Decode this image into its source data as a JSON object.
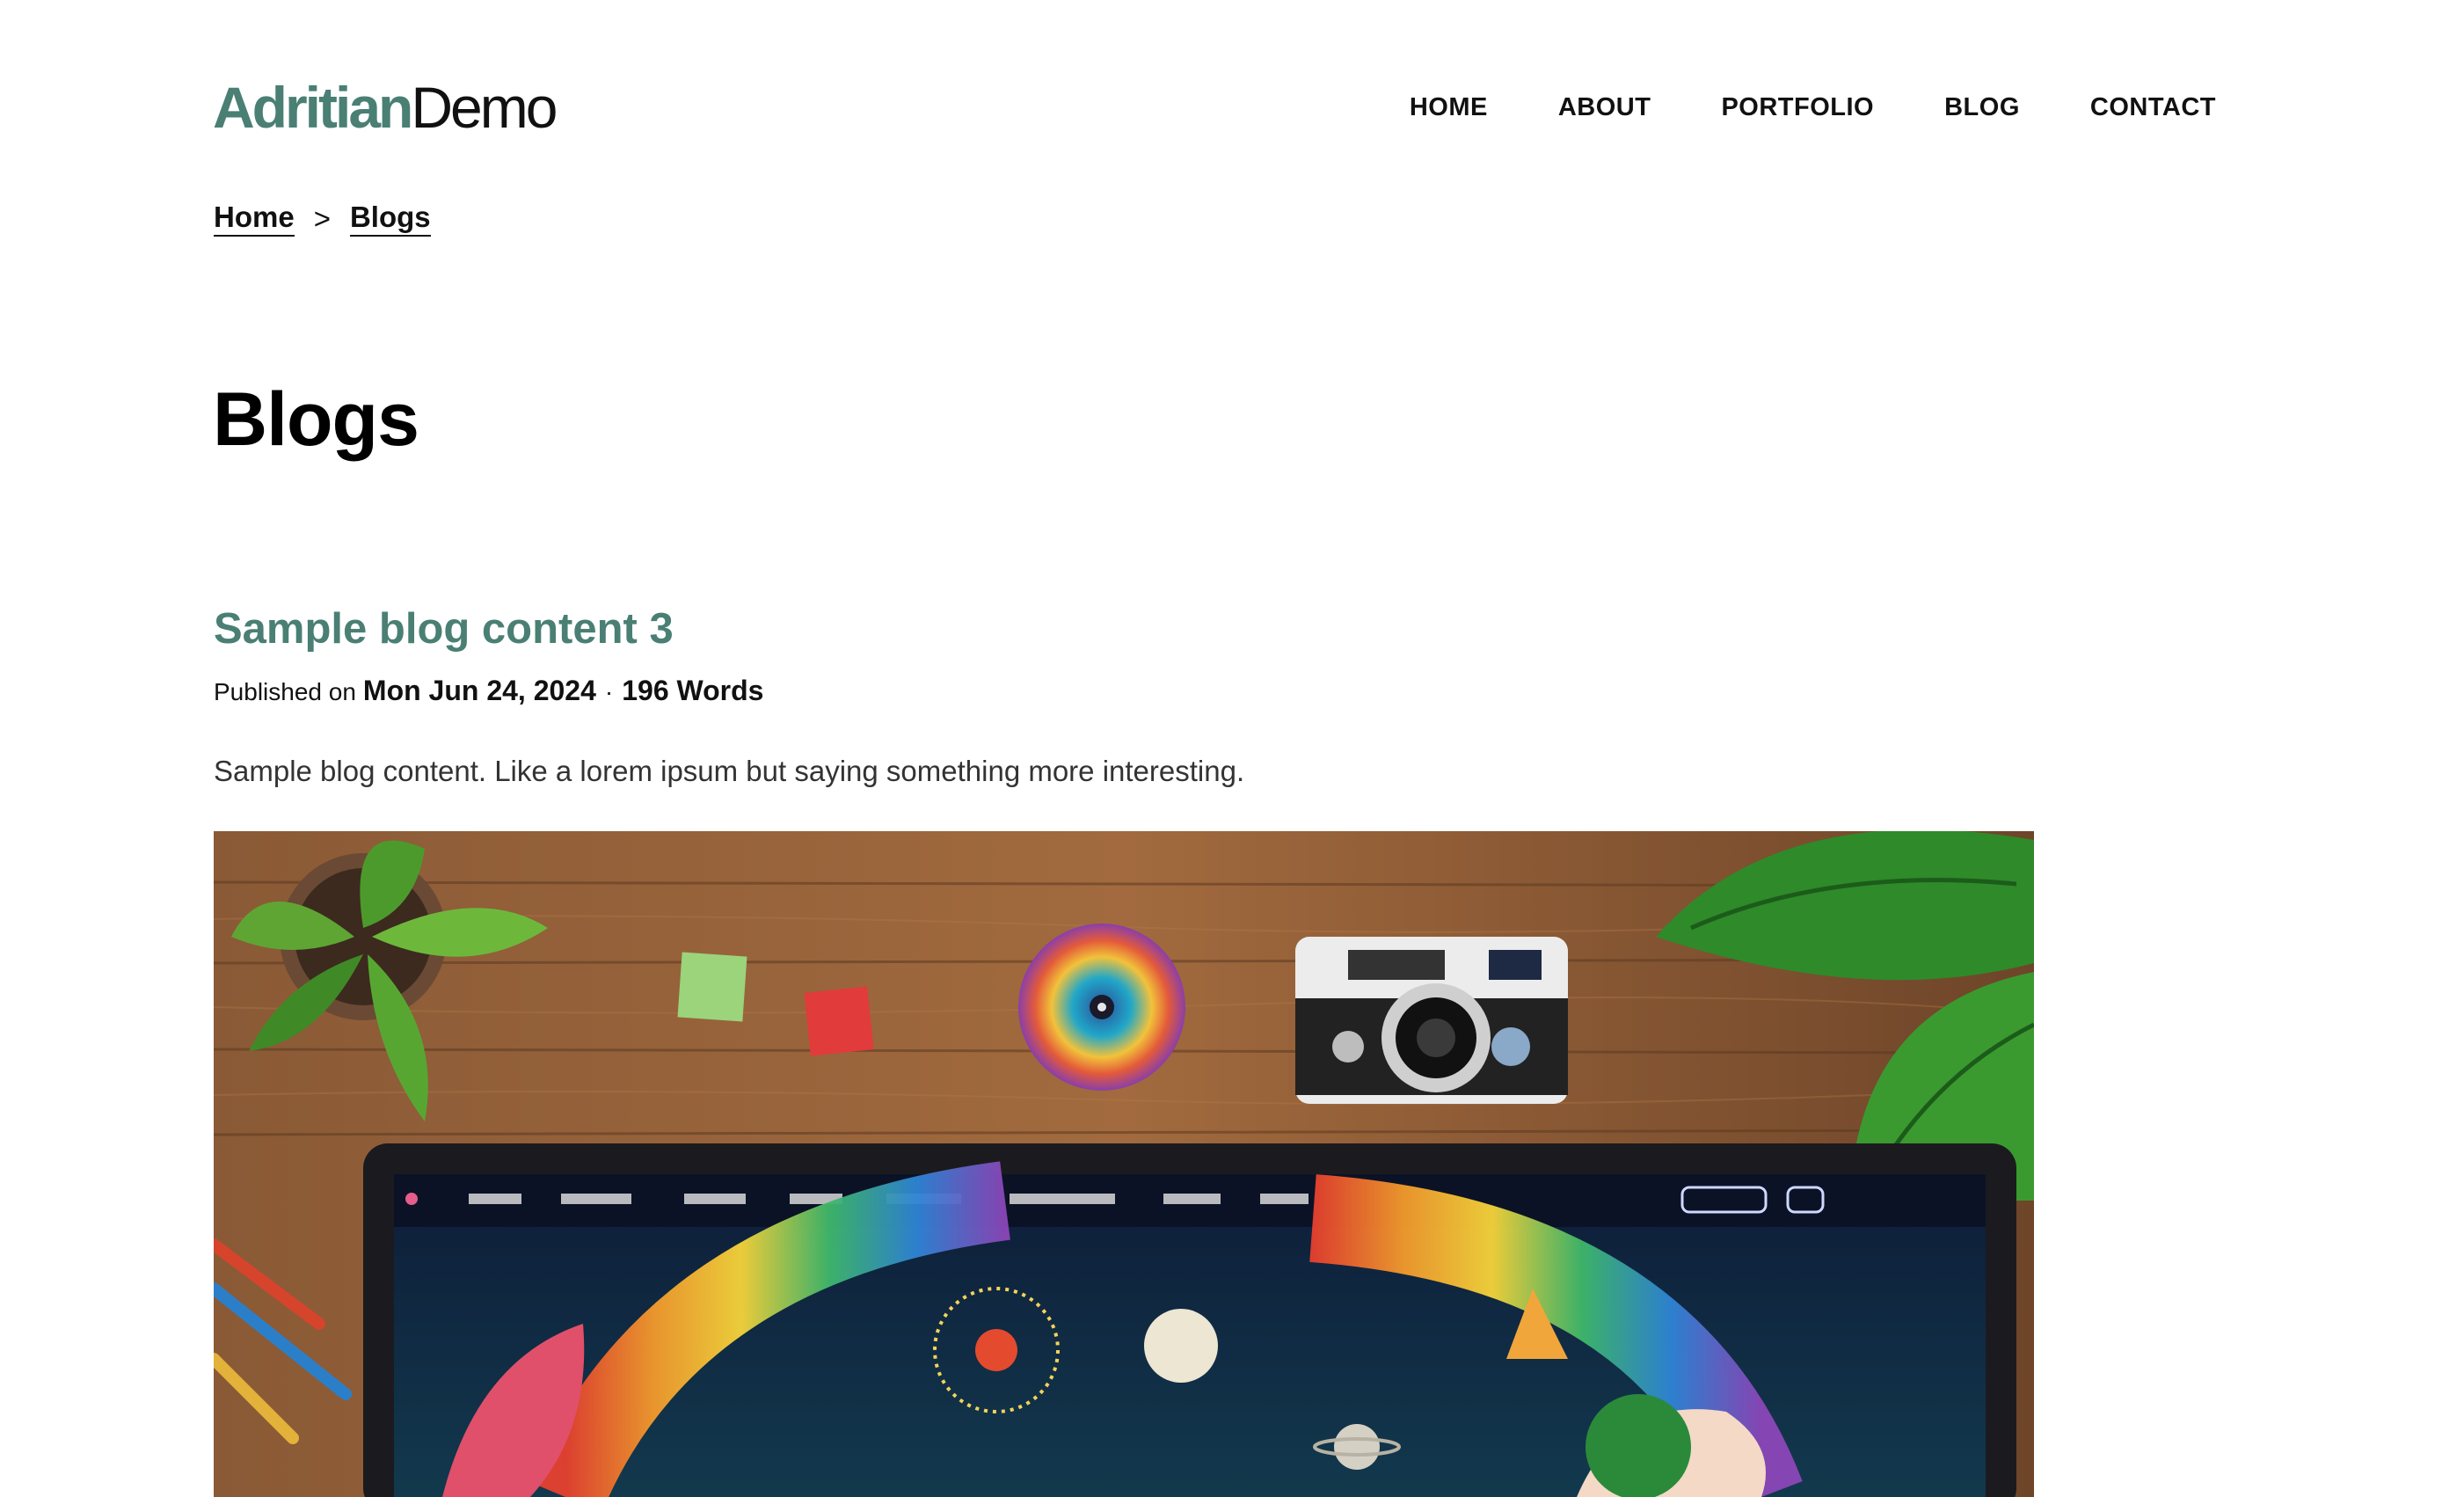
{
  "logo": {
    "brand": "Adritian",
    "suffix": "Demo"
  },
  "nav": {
    "items": [
      {
        "label": "HOME"
      },
      {
        "label": "ABOUT"
      },
      {
        "label": "PORTFOLIO"
      },
      {
        "label": "BLOG"
      },
      {
        "label": "CONTACT"
      }
    ]
  },
  "breadcrumb": {
    "home": "Home",
    "separator": ">",
    "current": "Blogs"
  },
  "page": {
    "title": "Blogs"
  },
  "post": {
    "title": "Sample blog content 3",
    "meta_prefix": "Published on",
    "date": "Mon Jun 24, 2024",
    "dot": "·",
    "words": "196 Words",
    "excerpt": "Sample blog content. Like a lorem ipsum but saying something more interesting."
  },
  "colors": {
    "accent": "#4a7f74",
    "text": "#111111",
    "background": "#ffffff"
  }
}
